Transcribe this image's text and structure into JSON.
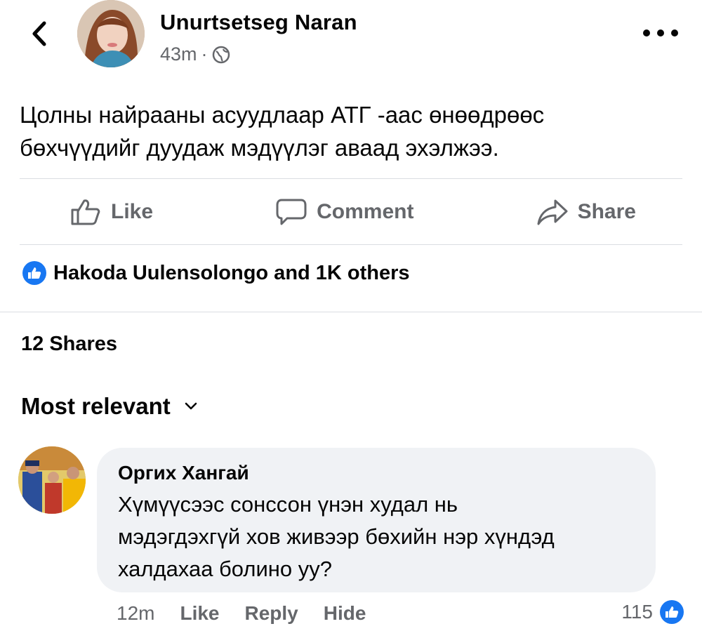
{
  "post": {
    "author": "Unurtsetseg Naran",
    "time": "43m",
    "separator": "·",
    "text_line1": "Цолны найрааны асуудлаар АТГ -аас өнөөдрөөс",
    "text_line2": "бөхчүүдийг дуудаж мэдүүлэг аваад эхэлжээ."
  },
  "actions": {
    "like": "Like",
    "comment": "Comment",
    "share": "Share"
  },
  "reactions": {
    "summary": "Hakoda Uulensolongo and 1K others"
  },
  "shares": "12 Shares",
  "sort": {
    "label": "Most relevant"
  },
  "comment": {
    "author": "Оргих Хангай",
    "text_line1": "Хүмүүсээс сонссон үнэн худал нь",
    "text_line2": "мэдэгдэхгүй хов живээр бөхийн нэр хүндэд",
    "text_line3": "халдахаа болино уу?",
    "time": "12m",
    "like": "Like",
    "reply": "Reply",
    "hide": "Hide",
    "reaction_count": "115"
  },
  "icons": {
    "back": "chevron-left-icon",
    "more": "more-horizontal-icon",
    "audience": "globe-icon",
    "like": "thumbs-up-icon",
    "comment": "speech-bubble-icon",
    "share": "share-arrow-icon",
    "sort": "chevron-down-icon"
  },
  "colors": {
    "accent": "#1877f2",
    "secondary_text": "#65676b",
    "bubble": "#f0f2f5"
  }
}
